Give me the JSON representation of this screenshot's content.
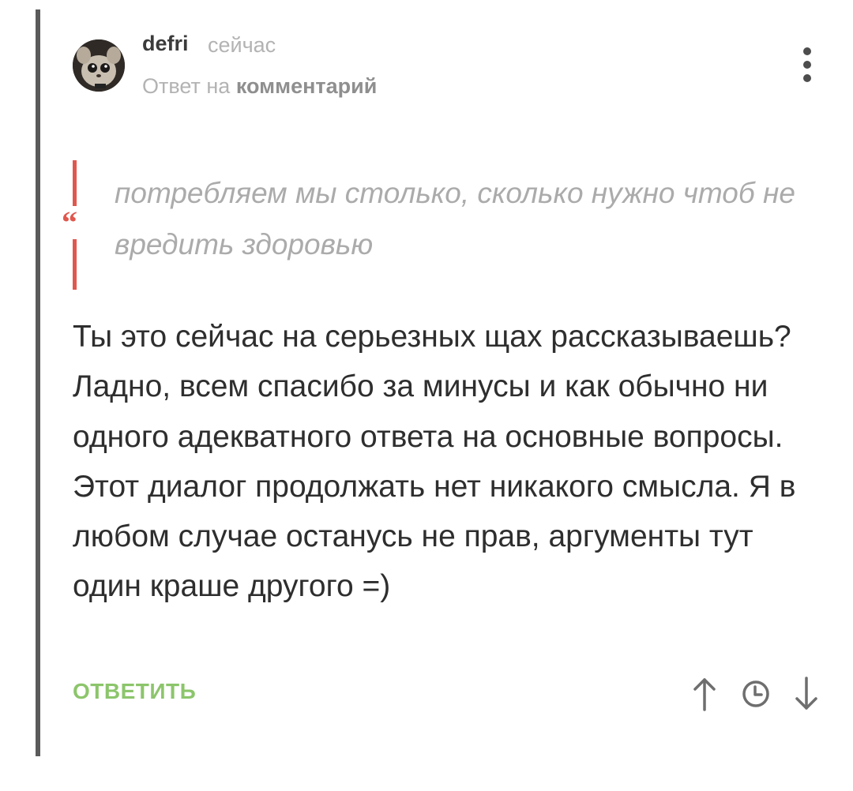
{
  "comment": {
    "author": "defri",
    "time": "сейчас",
    "reply_prefix": "Ответ на",
    "reply_link": "комментарий",
    "quote_text": "потребляем мы столько, сколько нужно чтоб не вредить здоровью",
    "quote_mark": "“",
    "body": "Ты это сейчас на серьезных щах рассказываешь? Ладно, всем спасибо за минусы и как обычно ни одного адекватного ответа на основные вопросы. Этот диалог продолжать нет никакого смысла. Я в любом случае останусь не прав, аргументы тут один краше другого =)"
  },
  "actions": {
    "reply_label": "ОТВЕТИТЬ",
    "up_icon": "arrow-up-icon",
    "time_icon": "clock-icon",
    "down_icon": "arrow-down-icon",
    "more_icon": "more-vertical-icon"
  },
  "colors": {
    "quote_accent": "#e0574d",
    "reply_green": "#8cc56b",
    "thread_line": "#5b5b5b"
  }
}
